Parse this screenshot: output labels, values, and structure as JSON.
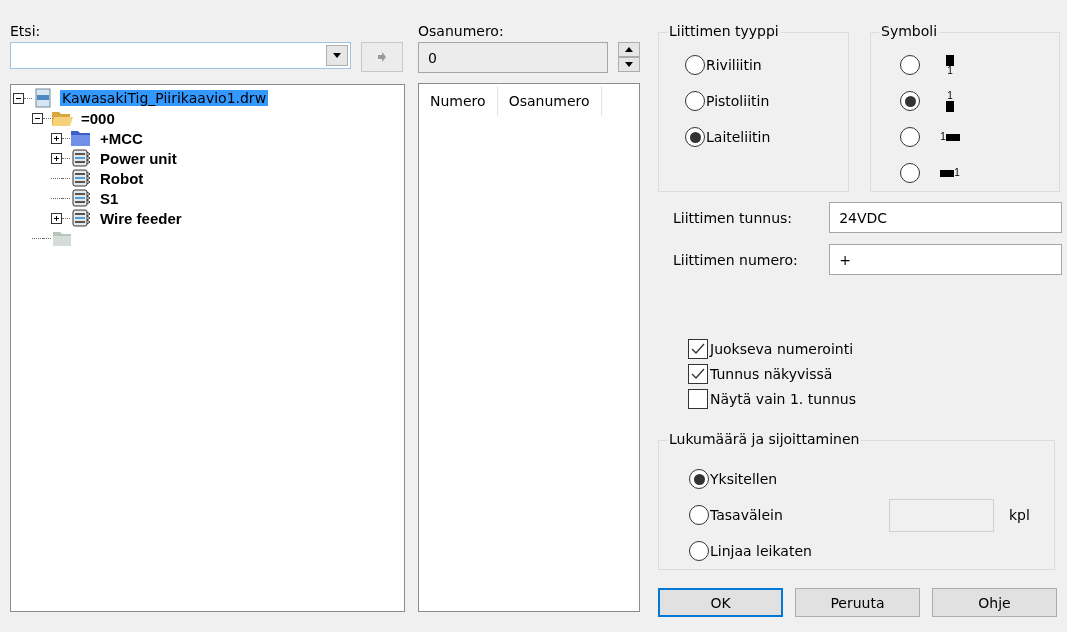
{
  "search": {
    "label": "Etsi:"
  },
  "tree": [
    {
      "label": "KawasakiTig_Piirikaavio1.drw",
      "kind": "file",
      "selected": true,
      "expanded": true,
      "children": [
        {
          "label": "=000",
          "kind": "folder-open",
          "selected": false,
          "expanded": true,
          "children": [
            {
              "label": "+MCC",
              "kind": "folder",
              "selected": false,
              "expanded": false
            },
            {
              "label": "Power unit",
              "kind": "device",
              "selected": false,
              "expanded": false
            },
            {
              "label": "Robot",
              "kind": "device",
              "selected": false
            },
            {
              "label": "S1",
              "kind": "device",
              "selected": false
            },
            {
              "label": "Wire feeder",
              "kind": "device",
              "selected": false,
              "expanded": false
            }
          ]
        },
        {
          "kind": "folder-empty"
        }
      ]
    }
  ],
  "part_number": {
    "label": "Osanumero:",
    "value": "0"
  },
  "part_table": {
    "columns": [
      "Numero",
      "Osanumero"
    ]
  },
  "connector_type": {
    "title": "Liittimen tyyppi",
    "options": [
      {
        "label": "Riviliitin",
        "selected": false
      },
      {
        "label": "Pistoliitin",
        "selected": false
      },
      {
        "label": "Laiteliitin",
        "selected": true
      }
    ]
  },
  "symbol": {
    "title": "Symboli",
    "options": [
      {
        "kind": "below",
        "number": "1",
        "selected": false
      },
      {
        "kind": "above",
        "number": "1",
        "selected": true
      },
      {
        "kind": "left",
        "number": "1",
        "selected": false
      },
      {
        "kind": "right",
        "number": "1",
        "selected": false
      }
    ]
  },
  "fields": [
    {
      "label": "Liittimen tunnus:",
      "value": "24VDC"
    },
    {
      "label": "Liittimen numero:",
      "value": "+"
    }
  ],
  "checkboxes": [
    {
      "label": "Juokseva numerointi",
      "checked": true
    },
    {
      "label": "Tunnus näkyvissä",
      "checked": true
    },
    {
      "label": "Näytä vain 1. tunnus",
      "checked": false
    }
  ],
  "placement": {
    "title": "Lukumäärä ja sijoittaminen",
    "options": [
      {
        "label": "Yksitellen",
        "selected": true
      },
      {
        "label": "Tasavälein",
        "selected": false
      },
      {
        "label": "Linjaa leikaten",
        "selected": false
      }
    ],
    "unit": "kpl"
  },
  "buttons": [
    {
      "label": "OK",
      "default": true
    },
    {
      "label": "Peruuta",
      "default": false
    },
    {
      "label": "Ohje",
      "default": false
    }
  ]
}
